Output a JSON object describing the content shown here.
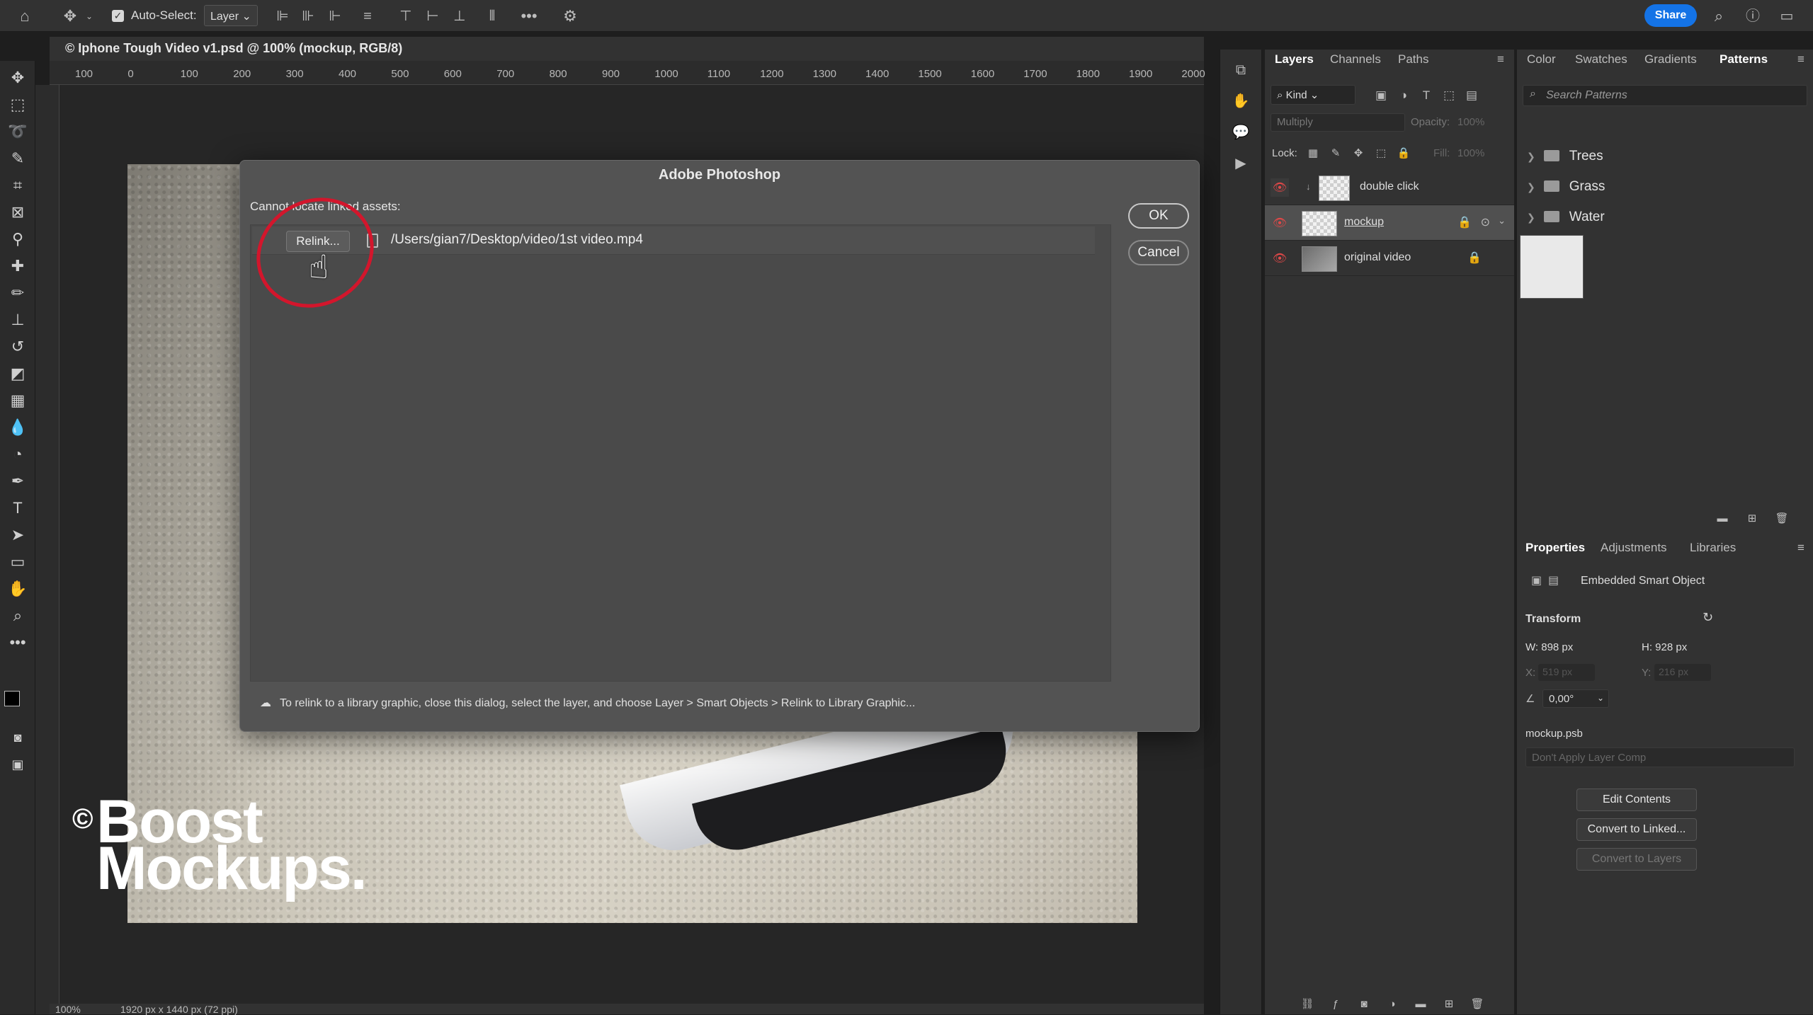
{
  "options_bar": {
    "auto_select_label": "Auto-Select:",
    "auto_select_value": "Layer",
    "share_label": "Share"
  },
  "document": {
    "tab_title": "© Iphone Tough Video v1.psd @ 100% (mockup, RGB/8)",
    "ruler_ticks": [
      "100",
      "0",
      "100",
      "200",
      "300",
      "400",
      "500",
      "600",
      "700",
      "800",
      "900",
      "1000",
      "1100",
      "1200",
      "1300",
      "1400",
      "1500",
      "1600",
      "1700",
      "1800",
      "1900",
      "2000"
    ],
    "status_zoom": "100%",
    "status_size": "1920 px x 1440 px (72 ppi)"
  },
  "watermark": {
    "copyright": "©",
    "line1": "Boost",
    "line2": "Mockups."
  },
  "dialog": {
    "title": "Adobe Photoshop",
    "message": "Cannot locate linked assets:",
    "relink_label": "Relink...",
    "asset_path": "/Users/gian7/Desktop/video/1st video.mp4",
    "ok_label": "OK",
    "cancel_label": "Cancel",
    "footer": "To relink to a library graphic, close this dialog, select the layer, and choose Layer > Smart Objects > Relink to Library Graphic..."
  },
  "layers_panel": {
    "tabs": [
      "Layers",
      "Channels",
      "Paths"
    ],
    "filter_kind": "Kind",
    "blend_mode": "Multiply",
    "opacity_label": "Opacity:",
    "opacity_value": "100%",
    "lock_label": "Lock:",
    "fill_label": "Fill:",
    "fill_value": "100%",
    "layers": [
      {
        "name": "double click"
      },
      {
        "name": "mockup"
      },
      {
        "name": "original video"
      }
    ]
  },
  "patterns_panel": {
    "tabs": [
      "Color",
      "Swatches",
      "Gradients",
      "Patterns"
    ],
    "search_placeholder": "Search Patterns",
    "folders": [
      "Trees",
      "Grass",
      "Water"
    ]
  },
  "properties_panel": {
    "tabs": [
      "Properties",
      "Adjustments",
      "Libraries"
    ],
    "type_label": "Embedded Smart Object",
    "transform_label": "Transform",
    "w": "W: 898 px",
    "h": "H: 928 px",
    "x": "X:",
    "x_value": "519 px",
    "y": "Y:",
    "y_value": "216 px",
    "angle": "0,00°",
    "filename": "mockup.psb",
    "layer_comp": "Don't Apply Layer Comp",
    "edit_contents": "Edit Contents",
    "convert_linked": "Convert to Linked...",
    "convert_layers": "Convert to Layers"
  }
}
